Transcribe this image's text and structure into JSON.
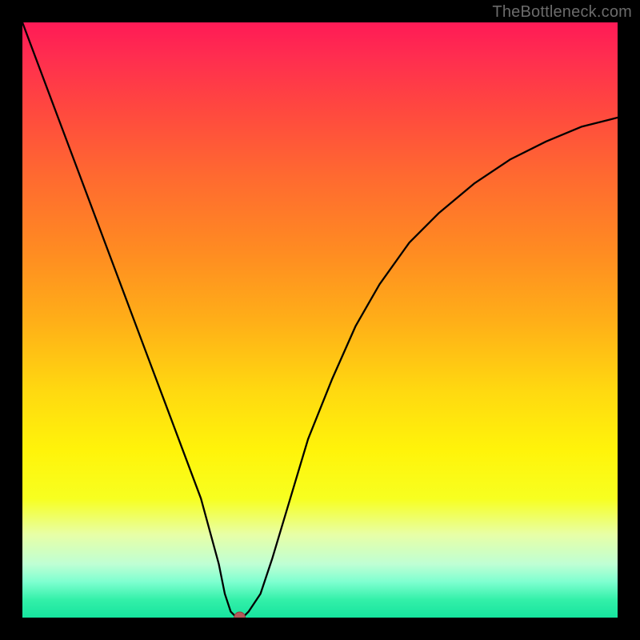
{
  "watermark": "TheBottleneck.com",
  "chart_data": {
    "type": "line",
    "title": "",
    "xlabel": "",
    "ylabel": "",
    "xlim": [
      0,
      100
    ],
    "ylim": [
      0,
      100
    ],
    "x": [
      0,
      3,
      6,
      9,
      12,
      15,
      18,
      21,
      24,
      27,
      30,
      33,
      34,
      35,
      36,
      37,
      38,
      40,
      42,
      45,
      48,
      52,
      56,
      60,
      65,
      70,
      76,
      82,
      88,
      94,
      100
    ],
    "values": [
      100,
      92,
      84,
      76,
      68,
      60,
      52,
      44,
      36,
      28,
      20,
      9,
      4,
      1,
      0,
      0,
      1,
      4,
      10,
      20,
      30,
      40,
      49,
      56,
      63,
      68,
      73,
      77,
      80,
      82.5,
      84
    ],
    "marker": {
      "x": 36.5,
      "y": 0
    },
    "colors": {
      "curve": "#000000",
      "marker": "#b35a5a",
      "gradient_top": "#ff1a56",
      "gradient_bottom": "#16e49e"
    }
  }
}
